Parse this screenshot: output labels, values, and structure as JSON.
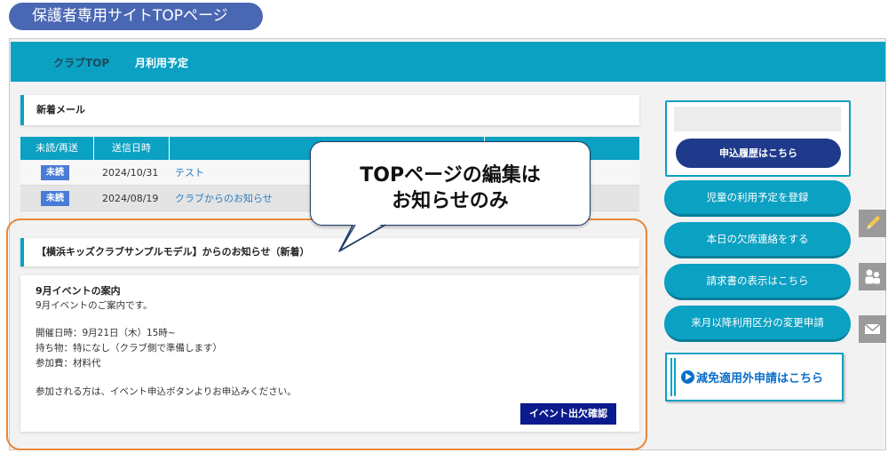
{
  "page_badge": "保護者専用サイトTOPページ",
  "nav": {
    "club_top": "クラブTOP",
    "monthly_plan": "月利用予定"
  },
  "mail": {
    "header": "新着メール",
    "columns": [
      "未読/再送",
      "送信日時",
      ""
    ],
    "rows": [
      {
        "badge": "未読",
        "date": "2024/10/31",
        "title": "テスト"
      },
      {
        "badge": "未読",
        "date": "2024/08/19",
        "title": "クラブからのお知らせ"
      }
    ]
  },
  "callout": {
    "line1": "TOPページの編集は",
    "line2": "お知らせのみ"
  },
  "notice": {
    "header": "【横浜キッズクラブサンプルモデル】からのお知らせ（新着）",
    "title": "9月イベントの案内",
    "intro": "9月イベントのご案内です。",
    "datetime": "開催日時：9月21日（木）15時~",
    "belongings": "持ち物：特になし（クラブ側で準備します）",
    "fee": "参加費：材料代",
    "apply": "参加される方は、イベント申込ボタンよりお申込みください。",
    "button": "イベント出欠確認"
  },
  "side": {
    "history_button": "申込履歴はこちら",
    "buttons": [
      "児童の利用予定を登録",
      "本日の欠席連絡をする",
      "請求書の表示はこちら",
      "来月以降利用区分の変更申請"
    ],
    "exempt_button": "減免適用外申請はこちら"
  },
  "colors": {
    "accent": "#0ba1c3",
    "badge_blue": "#4a67b3",
    "navy": "#1f3a8a",
    "orange": "#e8873a"
  },
  "icons": [
    "pencil-icon",
    "people-icon",
    "mail-icon"
  ]
}
